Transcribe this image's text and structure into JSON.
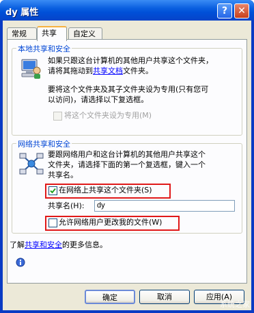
{
  "window": {
    "title": "dy 属性"
  },
  "title_buttons": {
    "help": "?",
    "close": "✕"
  },
  "tabs": [
    {
      "label": "常规",
      "active": false
    },
    {
      "label": "共享",
      "active": true
    },
    {
      "label": "自定义",
      "active": false
    }
  ],
  "local_sharing": {
    "title": "本地共享和安全",
    "line1": "如果只跟这台计算机的其他用户共享这个文件夹，",
    "line2_prefix": "请将其拖动到",
    "line2_link": "共享文档",
    "line2_suffix": "文件夹。",
    "line3": "要将这个文件夹及其子文件夹设为专用(只有您可",
    "line4": "以访问)，请选择以下复选框。",
    "private_checkbox": "将这个文件夹设为专用(M)"
  },
  "network_sharing": {
    "title": "网络共享和安全",
    "line1": "要跟网络用户和这台计算机的其他用户共享这个",
    "line2": "文件夹，请选择下面的第一个复选框，键入一个",
    "line3": "共享名。",
    "share_checkbox": {
      "label": "在网络上共享这个文件夹(S)",
      "checked": true
    },
    "share_name_label": "共享名(H):",
    "share_name_value": "dy",
    "allow_change_checkbox": {
      "label": "允许网络用户更改我的文件(W)",
      "checked": false
    },
    "learn_prefix": "了解",
    "learn_link": "共享和安全",
    "learn_suffix": "的更多信息。"
  },
  "buttons": {
    "ok": "确定",
    "cancel": "取消",
    "apply": "应用(A)"
  },
  "watermark": "系统之家"
}
